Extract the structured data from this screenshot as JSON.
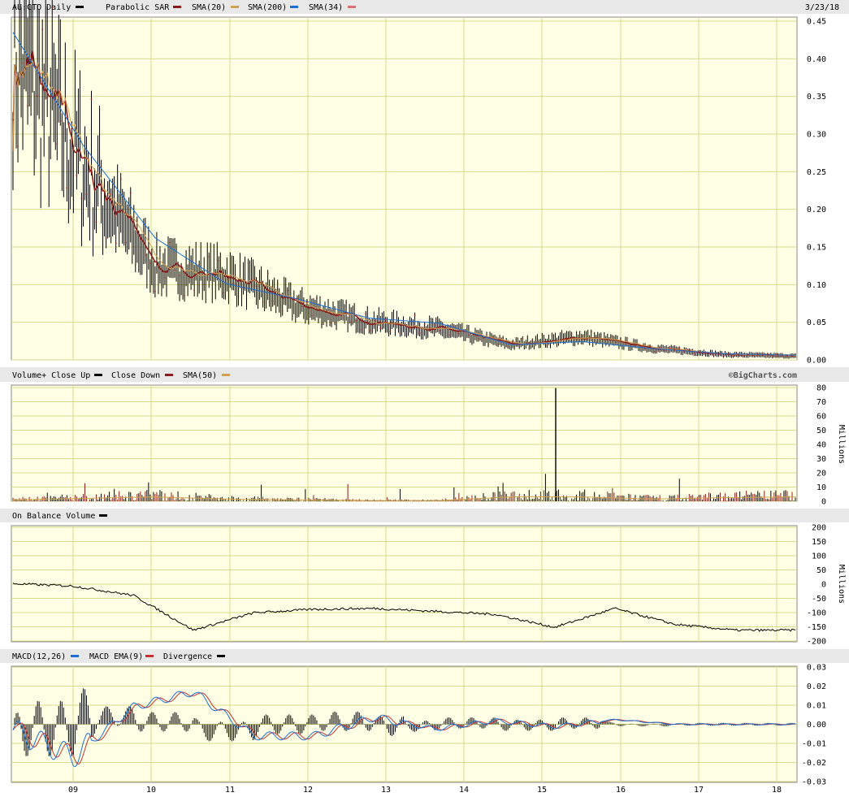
{
  "colors": {
    "plot_bg": "#ffffe6",
    "grid": "#d9d98c",
    "panel_border": "#888888",
    "price": "#000000",
    "sar": "#8b1a1a",
    "sma20": "#8b1a1a",
    "sma200": "#d2a050",
    "sma34": "#1a6fd8",
    "sma_short": "#e07070",
    "vol_up": "#000000",
    "vol_down": "#8b1a1a",
    "vol_sma": "#d2a050",
    "obv": "#000000",
    "macd": "#1a6fd8",
    "macd_ema": "#c83030",
    "divergence": "#000000",
    "header_band": "#e8e8e8"
  },
  "price_panel": {
    "header": {
      "symbol": "AU:CTO Daily",
      "legend": [
        {
          "label": "Parabolic SAR",
          "color": "#8b1a1a"
        },
        {
          "label": "SMA(20)",
          "color": "#d2a050"
        },
        {
          "label": "SMA(200)",
          "color": "#1a6fd8"
        },
        {
          "label": "SMA(34)",
          "color": "#e07070"
        }
      ],
      "date": "3/23/18"
    },
    "yticks": [
      "0.45",
      "0.40",
      "0.35",
      "0.30",
      "0.25",
      "0.20",
      "0.15",
      "0.10",
      "0.05",
      "0.00"
    ]
  },
  "volume_panel": {
    "header": {
      "legend": [
        {
          "label": "Volume+ Close Up",
          "color": "#000000"
        },
        {
          "label": "Close Down",
          "color": "#8b1a1a"
        },
        {
          "label": "SMA(50)",
          "color": "#d2a050"
        }
      ],
      "credit": "©BigCharts.com"
    },
    "yticks": [
      "80",
      "70",
      "60",
      "50",
      "40",
      "30",
      "20",
      "10",
      "0"
    ],
    "unit": "Millions"
  },
  "obv_panel": {
    "header": {
      "legend": [
        {
          "label": "On Balance Volume",
          "color": "#000000"
        }
      ]
    },
    "yticks": [
      "200",
      "150",
      "100",
      "50",
      "0",
      "-50",
      "-100",
      "-150",
      "-200"
    ],
    "unit": "Millions"
  },
  "macd_panel": {
    "header": {
      "legend": [
        {
          "label": "MACD(12,26)",
          "color": "#1a6fd8"
        },
        {
          "label": "MACD EMA(9)",
          "color": "#c83030"
        },
        {
          "label": "Divergence",
          "color": "#000000"
        }
      ]
    },
    "yticks": [
      "0.03",
      "0.02",
      "0.01",
      "0.00",
      "-0.01",
      "-0.02",
      "-0.03"
    ]
  },
  "xaxis": {
    "labels": [
      "09",
      "10",
      "11",
      "12",
      "13",
      "14",
      "15",
      "16",
      "17",
      "18"
    ]
  },
  "chart_data": [
    {
      "type": "line",
      "title": "AU:CTO Daily",
      "x": [
        "2008",
        "2009",
        "2010",
        "2011",
        "2012",
        "2013",
        "2014",
        "2015",
        "2016",
        "2017",
        "2018",
        "2018-03-23"
      ],
      "ylim": [
        0,
        0.45
      ],
      "series": [
        {
          "name": "AU:CTO Daily",
          "values": [
            0.4,
            0.25,
            0.12,
            0.11,
            0.07,
            0.05,
            0.04,
            0.02,
            0.03,
            0.015,
            0.007,
            0.005
          ]
        },
        {
          "name": "SMA(200)",
          "values": [
            0.43,
            0.28,
            0.16,
            0.1,
            0.08,
            0.055,
            0.048,
            0.02,
            0.024,
            0.015,
            0.008,
            0.006
          ]
        }
      ]
    },
    {
      "type": "bar",
      "title": "Volume+ Close Up",
      "ylabel": "Millions",
      "ylim": [
        0,
        80
      ],
      "x": [
        "2008",
        "2009",
        "2010",
        "2011",
        "2012",
        "2013",
        "2014",
        "2015",
        "2015-03",
        "2016",
        "2017",
        "2018"
      ],
      "values": [
        2,
        4,
        6,
        3,
        2,
        1,
        1,
        78,
        12,
        3,
        5,
        10
      ]
    },
    {
      "type": "line",
      "title": "On Balance Volume",
      "ylabel": "Millions",
      "ylim": [
        -200,
        200
      ],
      "x": [
        "2008",
        "2009",
        "2009-06",
        "2010",
        "2010-06",
        "2011",
        "2012",
        "2013",
        "2014",
        "2015",
        "2015-02",
        "2016",
        "2017",
        "2018"
      ],
      "values": [
        0,
        -8,
        -40,
        -160,
        -100,
        -88,
        -85,
        -95,
        -105,
        -150,
        -85,
        -140,
        -160,
        -160
      ]
    },
    {
      "type": "line",
      "title": "MACD(12,26)",
      "ylim": [
        -0.03,
        0.03
      ],
      "x": [
        "2008",
        "2008-06",
        "2008-09",
        "2009",
        "2009-06",
        "2010",
        "2011",
        "2012",
        "2013",
        "2014",
        "2015",
        "2016",
        "2017",
        "2018"
      ],
      "series": [
        {
          "name": "MACD(12,26)",
          "values": [
            -0.005,
            -0.028,
            0.015,
            0.028,
            -0.01,
            -0.01,
            0.006,
            -0.004,
            0.003,
            -0.002,
            0.004,
            0.0,
            0.0,
            0.0
          ]
        },
        {
          "name": "MACD EMA(9)",
          "values": [
            -0.004,
            -0.02,
            0.01,
            0.022,
            -0.008,
            -0.008,
            0.005,
            -0.003,
            0.002,
            -0.002,
            0.003,
            0.0,
            0.0,
            0.0
          ]
        }
      ]
    }
  ]
}
